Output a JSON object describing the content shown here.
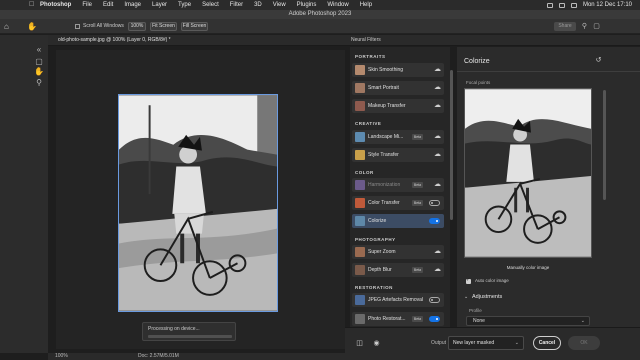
{
  "menubar": {
    "items": [
      "Photoshop",
      "File",
      "Edit",
      "Image",
      "Layer",
      "Type",
      "Select",
      "Filter",
      "3D",
      "View",
      "Plugins",
      "Window",
      "Help"
    ],
    "clock": "Mon 12 Dec 17:10"
  },
  "window": {
    "title": "Adobe Photoshop 2023"
  },
  "options": {
    "scroll_all_label": "Scroll All Windows",
    "zoom_btn": "100%",
    "fit_btn": "Fit Screen",
    "fill_btn": "Fill Screen",
    "share_btn": "Share"
  },
  "document": {
    "tab_label": "old-photo-sample.jpg @ 100% (Layer 0, RGB/8#) *",
    "zoom": "100%",
    "doc_size": "Doc: 2.57M/5.01M",
    "processing": "Processing on device..."
  },
  "neural": {
    "header": "Neural Filters",
    "categories": {
      "portraits": "PORTRAITS",
      "creative": "CREATIVE",
      "color": "COLOR",
      "photography": "PHOTOGRAPHY",
      "restoration": "RESTORATION"
    },
    "filters": {
      "skin": "Skin Smoothing",
      "smart": "Smart Portrait",
      "makeup": "Makeup Transfer",
      "landscape": "Landscape Mi...",
      "style": "Style Transfer",
      "harmonization": "Harmonization",
      "colortransfer": "Color Transfer",
      "colorize": "Colorize",
      "superzoom": "Super Zoom",
      "depthblur": "Depth Blur",
      "jpeg": "JPEG Artefacts Removal",
      "photorestore": "Photo Restorat..."
    },
    "beta": "Beta",
    "toggles": {
      "color_transfer_on": false,
      "colorize_on": true,
      "jpeg_on": false,
      "photorestore_on": true
    }
  },
  "panel": {
    "title": "Colorize",
    "focal_points": "Focal points",
    "manual": "Manually color image",
    "auto_color_label": "Auto color image",
    "auto_color_checked": true,
    "adjustments": "Adjustments",
    "profile_label": "Profile",
    "profile_value": "None"
  },
  "footer": {
    "output_label": "Output",
    "output_value": "New layer masked",
    "cancel": "Cancel",
    "ok": "OK"
  },
  "colors": {
    "accent": "#1473e6",
    "selection_border": "#6a9ae0"
  }
}
